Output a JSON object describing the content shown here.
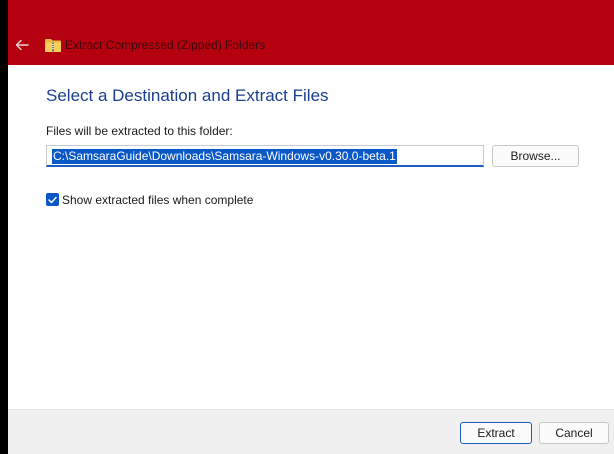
{
  "titlebar": {
    "title": "Extract Compressed (Zipped) Folders",
    "color": "#b5000f",
    "back_icon": "back-arrow-icon",
    "folder_icon": "zipped-folder-icon"
  },
  "main": {
    "heading": "Select a Destination and Extract Files",
    "path_label": "Files will be extracted to this folder:",
    "path_value": "C:\\SamsaraGuide\\Downloads\\Samsara-Windows-v0.30.0-beta.1",
    "browse_label": "Browse...",
    "show_files_label": "Show extracted files when complete",
    "show_files_checked": true
  },
  "footer": {
    "extract_label": "Extract",
    "cancel_label": "Cancel"
  }
}
